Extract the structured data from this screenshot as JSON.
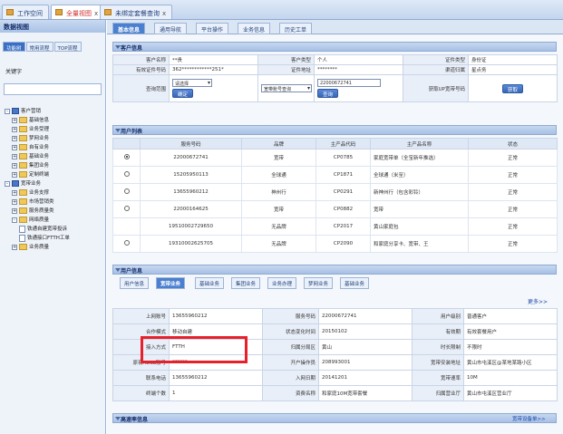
{
  "top_tabs": [
    {
      "label": "工作空间"
    },
    {
      "label": "全量视图"
    },
    {
      "label": "未绑定套餐查询"
    }
  ],
  "sidebar": {
    "title": "数据视图",
    "tabs": [
      "功能树",
      "常用流程",
      "TOP流程"
    ],
    "search_label": "关键字",
    "tree": [
      {
        "label": "客户营销",
        "level": 1,
        "kind": "blue",
        "pm": "-"
      },
      {
        "label": "基础信息",
        "level": 2,
        "kind": "fold",
        "pm": "+"
      },
      {
        "label": "业务受理",
        "level": 2,
        "kind": "fold",
        "pm": "+"
      },
      {
        "label": "梦网业务",
        "level": 2,
        "kind": "fold",
        "pm": "+"
      },
      {
        "label": "自有业务",
        "level": 2,
        "kind": "fold",
        "pm": "+"
      },
      {
        "label": "基础业务",
        "level": 2,
        "kind": "fold",
        "pm": "+"
      },
      {
        "label": "集团业务",
        "level": 2,
        "kind": "fold",
        "pm": "+"
      },
      {
        "label": "定制终端",
        "level": 2,
        "kind": "fold",
        "pm": "+"
      },
      {
        "label": "宽带业务",
        "level": 1,
        "kind": "blue",
        "pm": "-"
      },
      {
        "label": "业务支撑",
        "level": 2,
        "kind": "fold",
        "pm": "+"
      },
      {
        "label": "市场营销类",
        "level": 2,
        "kind": "fold",
        "pm": "+"
      },
      {
        "label": "服务质量类",
        "level": 2,
        "kind": "fold",
        "pm": "+"
      },
      {
        "label": "网络质量",
        "level": 2,
        "kind": "fold",
        "pm": "-"
      },
      {
        "label": "铁通自建宽带投诉",
        "level": 3,
        "kind": "doc",
        "pm": ""
      },
      {
        "label": "铁通接口FTTH工单",
        "level": 3,
        "kind": "doc",
        "pm": ""
      },
      {
        "label": "业务质量",
        "level": 2,
        "kind": "fold",
        "pm": "+"
      }
    ]
  },
  "main_tabs": [
    "基本信息",
    "通用导航",
    "平台操作",
    "业务信息",
    "历史工单"
  ],
  "customer": {
    "header": "客户信息",
    "rows": [
      [
        {
          "label": "客户名称",
          "value": "**贵"
        },
        {
          "label": "客户类型",
          "value": "个人"
        },
        {
          "label": "证件类型",
          "value": "身份证"
        }
      ],
      [
        {
          "label": "有效证件号码",
          "value": "362************251*"
        },
        {
          "label": "证件地址",
          "value": "********"
        },
        {
          "label": "渠道归属",
          "value": "星点务"
        }
      ]
    ],
    "query_label": "查询范围",
    "query_select": "请选择",
    "query_confirm": "确定",
    "query_type_select": "宽带账号查询",
    "query_input": "22000672741",
    "query_btn": "查询",
    "fetch_label": "获取UP宽带号码",
    "fetch_btn": "获取"
  },
  "users": {
    "header": "用户列表",
    "columns": [
      "",
      "服务号码",
      "品牌",
      "主产品代码",
      "主产品名称",
      "状态"
    ],
    "rows": [
      {
        "selected": true,
        "number": "22000672741",
        "brand": "宽带",
        "code": "CP0785",
        "name": "家庭宽带单（全宝新年推选）",
        "status": "正常"
      },
      {
        "selected": false,
        "number": "15205950113",
        "brand": "全球通",
        "code": "CP1871",
        "name": "全球通（米至）",
        "status": "正常"
      },
      {
        "selected": false,
        "number": "13655960212",
        "brand": "神州行",
        "code": "CP0291",
        "name": "新神州行（包含彩铃）",
        "status": "正常"
      },
      {
        "selected": false,
        "number": "22000164625",
        "brand": "宽带",
        "code": "CP0882",
        "name": "宽带",
        "status": "正常"
      },
      {
        "selected": null,
        "number": "19510002729650",
        "brand": "无品牌",
        "code": "CP2017",
        "name": "黄山家庭包",
        "status": "正常"
      },
      {
        "selected": false,
        "number": "19310002625705",
        "brand": "无品牌",
        "code": "CP2090",
        "name": "和家庭分享卡、宽带、王",
        "status": "正常"
      }
    ]
  },
  "user_info": {
    "header": "用户信息",
    "tabs": [
      "用户信息",
      "宽带业务",
      "基础业务",
      "集团业务",
      "业务办理",
      "梦网业务",
      "基础业务"
    ],
    "more": "更多>>",
    "rows": [
      [
        {
          "label": "上网账号",
          "value": "13655960212"
        },
        {
          "label": "服务号码",
          "value": "22000672741"
        },
        {
          "label": "用户级别",
          "value": "普通客户"
        }
      ],
      [
        {
          "label": "合作模式",
          "value": "移动自建"
        },
        {
          "label": "状态变化时间",
          "value": "20150102"
        },
        {
          "label": "有效期",
          "value": "有效套餐用户"
        }
      ],
      [
        {
          "label": "接入方式",
          "value": "FTTH"
        },
        {
          "label": "归属分局区",
          "value": "黄山"
        },
        {
          "label": "时长限制",
          "value": "不限时"
        }
      ],
      [
        {
          "label": "原有ADSL账号",
          "value": "******"
        },
        {
          "label": "开户操作员",
          "value": "208993001"
        },
        {
          "label": "宽带安装地址",
          "value": "黄山市屯溪区@某地某路小区"
        }
      ],
      [
        {
          "label": "联系电话",
          "value": "13655960212"
        },
        {
          "label": "入网日期",
          "value": "20141201"
        },
        {
          "label": "宽带速率",
          "value": "10M"
        }
      ],
      [
        {
          "label": "终端个数",
          "value": "1"
        },
        {
          "label": "资费名称",
          "value": "和家庭10M宽带套餐"
        },
        {
          "label": "归属营业厅",
          "value": "黄山市屯溪区营业厅"
        }
      ]
    ]
  },
  "bottom": {
    "header": "高速率信息",
    "link": "宽带设备单>>"
  }
}
